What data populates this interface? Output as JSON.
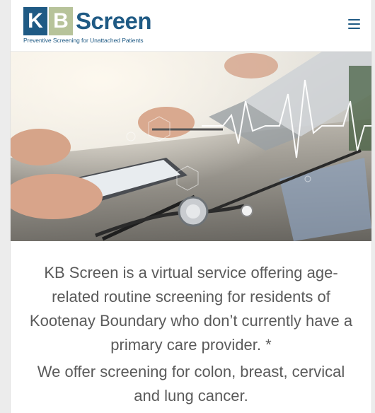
{
  "logo": {
    "letter_k": "K",
    "letter_b": "B",
    "word": "Screen",
    "tagline": "Preventive Screening for Unattached Patients"
  },
  "nav": {
    "menu_icon": "hamburger-menu-icon"
  },
  "hero": {
    "subject": "doctor at desk with stethoscope, tablet and laptop"
  },
  "content": {
    "intro": "KB Screen is a virtual service offering age-related routine screening for residents of Kootenay Boundary who don’t currently have a primary care provider. *",
    "offer": "We offer screening for colon, breast, cervical and lung cancer."
  },
  "colors": {
    "brand_blue": "#1f5a84",
    "brand_green": "#b7c39a",
    "text_gray": "#5a5a5a"
  }
}
